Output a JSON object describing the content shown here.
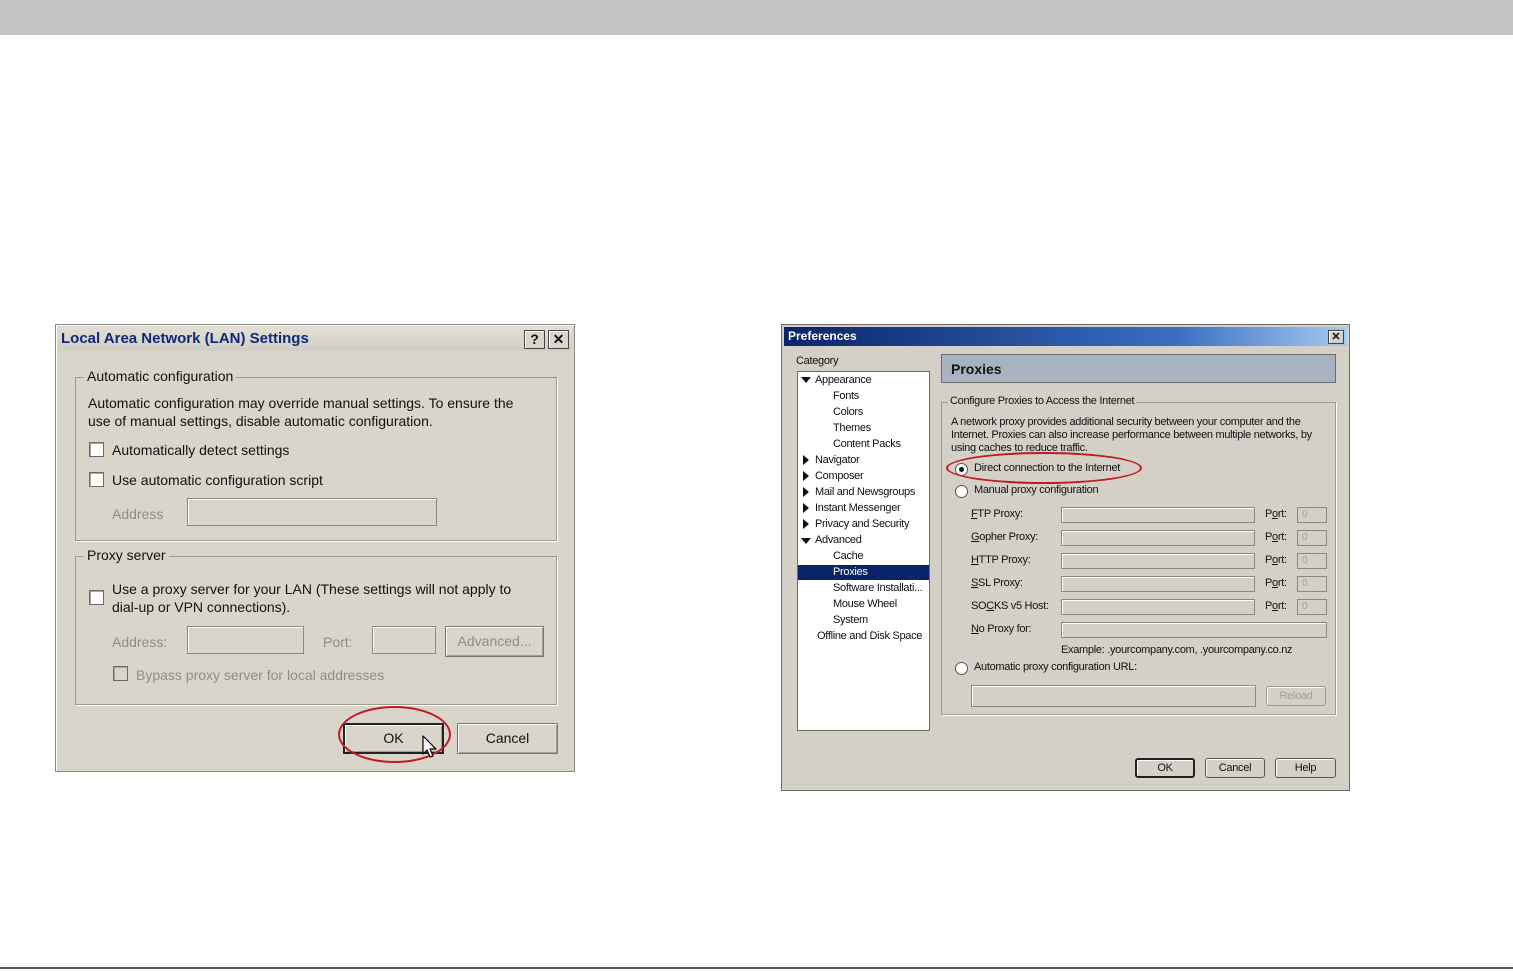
{
  "lan_dialog": {
    "title": "Local Area Network (LAN) Settings",
    "help_button": "?",
    "close_button": "✕",
    "auto_config": {
      "legend": "Automatic configuration",
      "description_line1": "Automatic configuration may override manual settings.  To ensure the",
      "description_line2": "use of manual settings, disable automatic configuration.",
      "detect_settings_label": "Automatically detect settings",
      "detect_settings_checked": false,
      "use_script_label": "Use automatic configuration script",
      "use_script_checked": false,
      "address_label": "Address",
      "address_value": ""
    },
    "proxy_server": {
      "legend": "Proxy server",
      "use_proxy_line1": "Use a proxy server for your LAN (These settings will not apply to",
      "use_proxy_line2": "dial-up or VPN connections).",
      "use_proxy_checked": false,
      "address_label": "Address:",
      "address_value": "",
      "port_label": "Port:",
      "port_value": "",
      "advanced_button": "Advanced...",
      "bypass_label": "Bypass proxy server for local addresses",
      "bypass_checked": false
    },
    "ok_button": "OK",
    "cancel_button": "Cancel",
    "highlight_color": "#c01a22"
  },
  "prefs_dialog": {
    "title": "Preferences",
    "close_button": "✕",
    "category_label": "Category",
    "tree": [
      {
        "label": "Appearance",
        "level": 0,
        "expander": "expanded"
      },
      {
        "label": "Fonts",
        "level": 1
      },
      {
        "label": "Colors",
        "level": 1
      },
      {
        "label": "Themes",
        "level": 1
      },
      {
        "label": "Content Packs",
        "level": 1
      },
      {
        "label": "Navigator",
        "level": 0,
        "expander": "collapsed"
      },
      {
        "label": "Composer",
        "level": 0,
        "expander": "collapsed"
      },
      {
        "label": "Mail and Newsgroups",
        "level": 0,
        "expander": "collapsed"
      },
      {
        "label": "Instant Messenger",
        "level": 0,
        "expander": "collapsed"
      },
      {
        "label": "Privacy and Security",
        "level": 0,
        "expander": "collapsed"
      },
      {
        "label": "Advanced",
        "level": 0,
        "expander": "expanded"
      },
      {
        "label": "Cache",
        "level": 1
      },
      {
        "label": "Proxies",
        "level": 1,
        "selected": true
      },
      {
        "label": "Software Installati...",
        "level": 1
      },
      {
        "label": "Mouse Wheel",
        "level": 1
      },
      {
        "label": "System",
        "level": 1
      },
      {
        "label": "Offline and Disk Space",
        "level": 0
      }
    ],
    "panel_title": "Proxies",
    "group_legend": "Configure Proxies to Access the Internet",
    "description_line1": "A network proxy provides additional security between your computer and the",
    "description_line2": "Internet. Proxies can also increase performance between multiple networks, by",
    "description_line3": "using caches to reduce traffic.",
    "direct_label": "Direct connection to the Internet",
    "direct_selected": true,
    "manual_label": "Manual proxy configuration",
    "manual_selected": false,
    "proxies": [
      {
        "accel": "F",
        "rest": "TP Proxy:",
        "port": "0"
      },
      {
        "accel": "G",
        "rest": "opher Proxy:",
        "port": "0"
      },
      {
        "accel": "H",
        "rest": "TTP Proxy:",
        "port": "0"
      },
      {
        "accel": "S",
        "rest": "SL Proxy:",
        "port": "0"
      },
      {
        "pre": "SO",
        "accel": "C",
        "rest": "KS v5 Host:",
        "port": "0"
      }
    ],
    "port_label_pre": "P",
    "port_label_accel": "o",
    "port_label_rest": "rt:",
    "no_proxy_accel": "N",
    "no_proxy_rest": "o Proxy for:",
    "example_text": "Example: .yourcompany.com, .yourcompany.co.nz",
    "auto_url_label": "Automatic proxy configuration URL:",
    "auto_url_selected": false,
    "reload_button": "Reload",
    "ok_button": "OK",
    "cancel_button": "Cancel",
    "help_button": "Help"
  }
}
